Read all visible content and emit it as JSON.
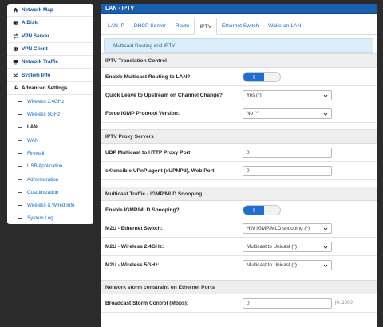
{
  "sidebar": {
    "items": [
      {
        "label": "Network Map",
        "icon": "home-icon"
      },
      {
        "label": "AiDisk",
        "icon": "drive-icon"
      },
      {
        "label": "VPN Server",
        "icon": "transfer-icon"
      },
      {
        "label": "VPN Client",
        "icon": "globe-icon"
      },
      {
        "label": "Network Traffic",
        "icon": "monitor-icon"
      },
      {
        "label": "System Info",
        "icon": "shuffle-icon"
      },
      {
        "label": "Advanced Settings",
        "icon": "wrench-icon"
      }
    ],
    "subitems": [
      {
        "label": "Wireless 2.4GHz"
      },
      {
        "label": "Wireless 5GHz"
      },
      {
        "label": "LAN"
      },
      {
        "label": "WAN"
      },
      {
        "label": "Firewall"
      },
      {
        "label": "USB Application"
      },
      {
        "label": "Administration"
      },
      {
        "label": "Customization"
      },
      {
        "label": "Wireless & Wired Info"
      },
      {
        "label": "System Log"
      }
    ],
    "current_sub": "LAN"
  },
  "panel": {
    "title": "LAN - IPTV",
    "tabs": [
      "LAN IP",
      "DHCP Server",
      "Route",
      "IPTV",
      "Ethernet Switch",
      "Wake-on-LAN"
    ],
    "active_tab": "IPTV",
    "info": "Multicast Routing and IPTV"
  },
  "sections": {
    "translation": {
      "head": "IPTV Translation Control",
      "multicast_routing_label": "Enable Multicast Routing to LAN?",
      "multicast_routing_toggle": "I",
      "quick_leave_label": "Quick Leave to Upstream on Channel Change?",
      "quick_leave_value": "Yes (*)",
      "force_igmp_label": "Force IGMP Protocol Version:",
      "force_igmp_value": "No (*)"
    },
    "proxy": {
      "head": "IPTV Proxy Servers",
      "udp_label": "UDP Multicast to HTTP Proxy Port:",
      "udp_value": "0",
      "xupnp_label": "eXtensible UPnP agent (xUPNPd), Web Port:",
      "xupnp_value": "0"
    },
    "snooping": {
      "head": "Multicast Traffic - IGMP/MLD Snooping",
      "enable_label": "Enable IGMP/MLD Snooping?",
      "enable_toggle": "I",
      "m2u_eth_label": "M2U - Ethernet Switch:",
      "m2u_eth_value": "HW IGMP/MLD snooping (*)",
      "m2u_24_label": "M2U - Wireless 2.4GHz:",
      "m2u_24_value": "Multicast to Unicast (*)",
      "m2u_5_label": "M2U - Wireless 5GHz:",
      "m2u_5_value": "Multicast to Unicast (*)"
    },
    "storm": {
      "head": "Network storm constraint on Ethernet Ports",
      "broadcast_label": "Broadcast Storm Control (Mbps):",
      "broadcast_value": "0",
      "broadcast_hint": "[0..1000]"
    }
  },
  "colors": {
    "accent": "#1a5fb0",
    "link": "#0a6ad0",
    "toggle_on": "#1e6fd0",
    "info_bg": "#dcedf7"
  }
}
